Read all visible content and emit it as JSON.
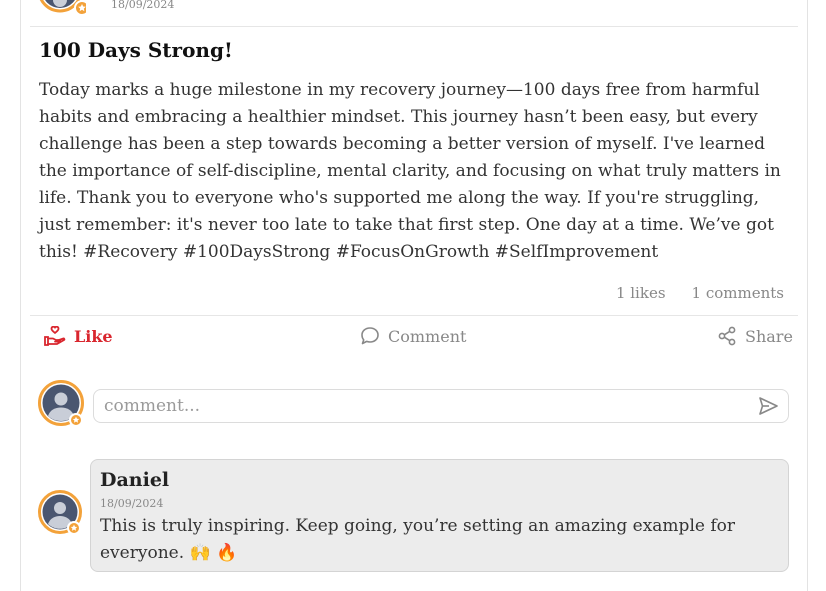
{
  "post": {
    "date": "18/09/2024",
    "title": "100 Days Strong!",
    "body": "Today marks a huge milestone in my recovery journey—100 days free from harmful habits and embracing a healthier mindset. This journey hasn’t been easy, but every challenge has been a step towards becoming a better version of myself. I've learned the importance of self-discipline, mental clarity, and focusing on what truly matters in life. Thank you to everyone who's supported me along the way. If you're struggling, just remember: it's never too late to take that first step. One day at a time. We’ve got this! #Recovery #100DaysStrong #FocusOnGrowth #SelfImprovement",
    "likes_text": "1 likes",
    "comments_text": "1 comments"
  },
  "actions": {
    "like_label": "Like",
    "comment_label": "Comment",
    "share_label": "Share"
  },
  "composer": {
    "placeholder": "comment..."
  },
  "comments": [
    {
      "author": "Daniel",
      "date": "18/09/2024",
      "text": "This is truly inspiring. Keep going, you’re setting an amazing example for everyone. 🙌 🔥"
    }
  ],
  "icons": {
    "avatar": "user-avatar-icon",
    "badge": "star-badge-icon",
    "like": "hand-heart-icon",
    "comment": "speech-bubble-icon",
    "share": "share-nodes-icon",
    "send": "send-arrow-icon"
  },
  "colors": {
    "accent": "#d9262e",
    "badge": "#f3a23a",
    "avatar_fill": "#4a5670",
    "bubble_bg": "#ececec"
  }
}
